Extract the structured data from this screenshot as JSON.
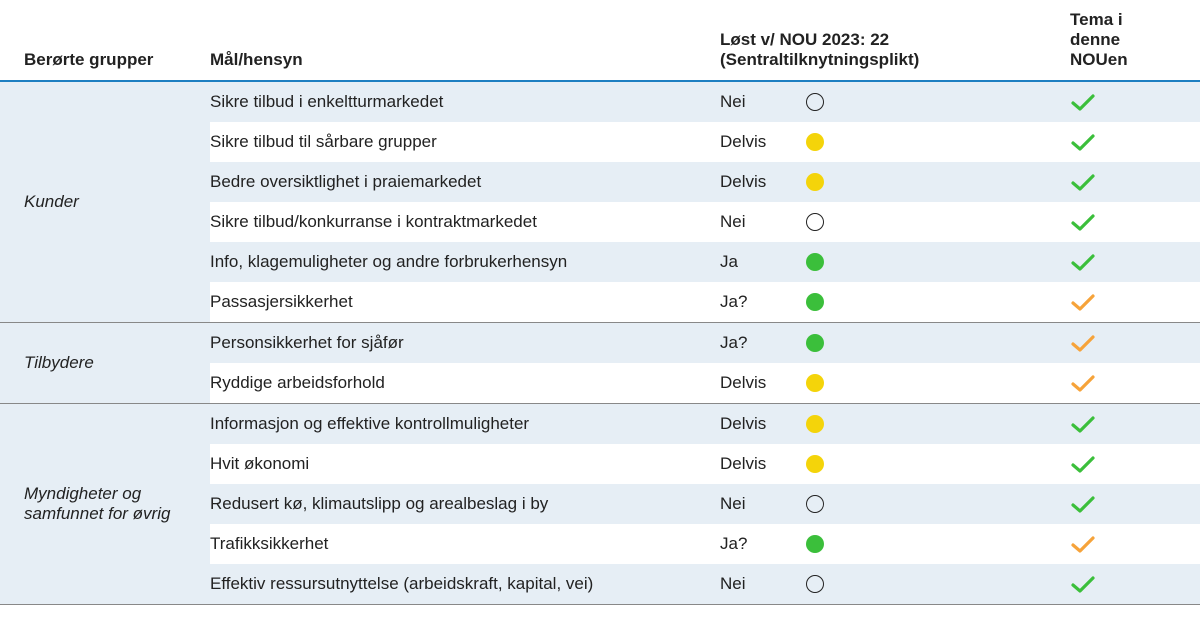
{
  "headers": {
    "group": "Berørte grupper",
    "goal": "Mål/hensyn",
    "solved_line1": "Løst v/ NOU 2023: 22",
    "solved_line2": "(Sentraltilknytningsplikt)",
    "theme_line1": "Tema i",
    "theme_line2": "denne",
    "theme_line3": "NOUen"
  },
  "status_colors": {
    "none": "#ffffff",
    "yellow": "#f4d40a",
    "green": "#3bbf3b"
  },
  "check_colors": {
    "green": "#3bbf3b",
    "orange": "#f6a33a"
  },
  "groups": [
    {
      "label": "Kunder",
      "rows": [
        {
          "goal": "Sikre tilbud i enkeltturmarkedet",
          "solved": "Nei",
          "circle": "none",
          "theme_check": "green"
        },
        {
          "goal": "Sikre tilbud til sårbare grupper",
          "solved": "Delvis",
          "circle": "yellow",
          "theme_check": "green"
        },
        {
          "goal": "Bedre oversiktlighet i praiemarkedet",
          "solved": "Delvis",
          "circle": "yellow",
          "theme_check": "green"
        },
        {
          "goal": "Sikre tilbud/konkurranse i kontraktmarkedet",
          "solved": "Nei",
          "circle": "none",
          "theme_check": "green"
        },
        {
          "goal": "Info, klagemuligheter og andre forbrukerhensyn",
          "solved": "Ja",
          "circle": "green",
          "theme_check": "green"
        },
        {
          "goal": "Passasjersikkerhet",
          "solved": "Ja?",
          "circle": "green",
          "theme_check": "orange"
        }
      ]
    },
    {
      "label": "Tilbydere",
      "rows": [
        {
          "goal": "Personsikkerhet for sjåfør",
          "solved": "Ja?",
          "circle": "green",
          "theme_check": "orange"
        },
        {
          "goal": "Ryddige arbeidsforhold",
          "solved": "Delvis",
          "circle": "yellow",
          "theme_check": "orange"
        }
      ]
    },
    {
      "label": "Myndigheter og samfunnet for øvrig",
      "rows": [
        {
          "goal": "Informasjon og effektive kontrollmuligheter",
          "solved": "Delvis",
          "circle": "yellow",
          "theme_check": "green"
        },
        {
          "goal": "Hvit økonomi",
          "solved": "Delvis",
          "circle": "yellow",
          "theme_check": "green"
        },
        {
          "goal": "Redusert kø, klimautslipp og arealbeslag i by",
          "solved": "Nei",
          "circle": "none",
          "theme_check": "green"
        },
        {
          "goal": "Trafikksikkerhet",
          "solved": "Ja?",
          "circle": "green",
          "theme_check": "orange"
        },
        {
          "goal": "Effektiv ressursutnyttelse (arbeidskraft, kapital, vei)",
          "solved": "Nei",
          "circle": "none",
          "theme_check": "green"
        }
      ]
    }
  ]
}
